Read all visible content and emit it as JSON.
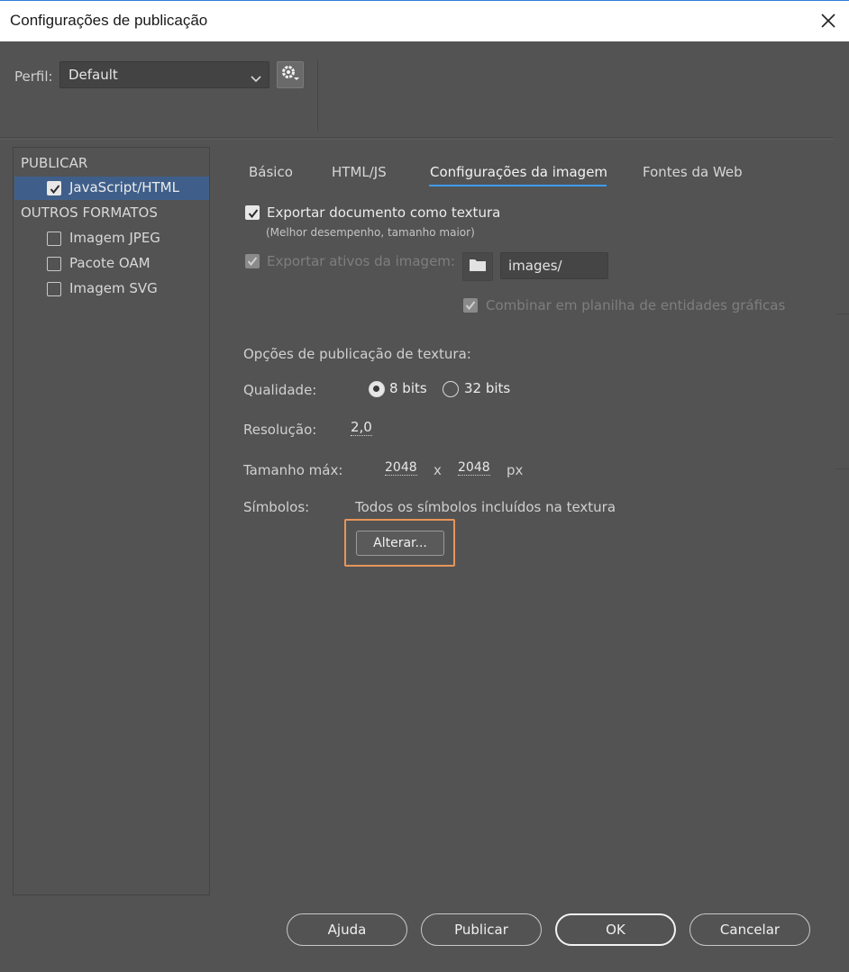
{
  "window": {
    "title": "Configurações de publicação"
  },
  "profile": {
    "label": "Perfil:",
    "value": "Default"
  },
  "sidebar": {
    "publish_header": "PUBLICAR",
    "publish_items": [
      {
        "label": "JavaScript/HTML",
        "checked": true
      }
    ],
    "other_header": "OUTROS FORMATOS",
    "other_items": [
      {
        "label": "Imagem JPEG",
        "checked": false
      },
      {
        "label": "Pacote OAM",
        "checked": false
      },
      {
        "label": "Imagem SVG",
        "checked": false
      }
    ]
  },
  "tabs": [
    {
      "label": "Básico",
      "active": false
    },
    {
      "label": "HTML/JS",
      "active": false
    },
    {
      "label": "Configurações da imagem",
      "active": true
    },
    {
      "label": "Fontes da Web",
      "active": false
    }
  ],
  "image_settings": {
    "export_texture_label": "Exportar documento como textura",
    "export_texture_checked": true,
    "export_texture_hint": "(Melhor desempenho, tamanho maior)",
    "export_assets_label": "Exportar ativos da imagem:",
    "export_assets_checked": true,
    "export_assets_enabled": false,
    "assets_path": "images/",
    "combine_spritesheet_label": "Combinar em planilha de entidades gráficas",
    "combine_spritesheet_checked": true,
    "combine_spritesheet_enabled": false,
    "texture_options_heading": "Opções de publicação de textura:",
    "quality_label": "Qualidade:",
    "quality_options": [
      {
        "label": "8 bits",
        "selected": true
      },
      {
        "label": "32 bits",
        "selected": false
      }
    ],
    "resolution_label": "Resolução:",
    "resolution_value": "2,0",
    "max_size_label": "Tamanho máx:",
    "max_width": "2048",
    "times_symbol": "x",
    "max_height": "2048",
    "unit": "px",
    "symbols_label": "Símbolos:",
    "symbols_value": "Todos os símbolos incluídos na textura",
    "change_button": "Alterar..."
  },
  "footer": {
    "help": "Ajuda",
    "publish": "Publicar",
    "ok": "OK",
    "cancel": "Cancelar"
  },
  "colors": {
    "background": "#535353",
    "selection": "#3f5f8a",
    "tab_underline": "#3e9cf0",
    "highlight_frame": "#e8955a"
  }
}
